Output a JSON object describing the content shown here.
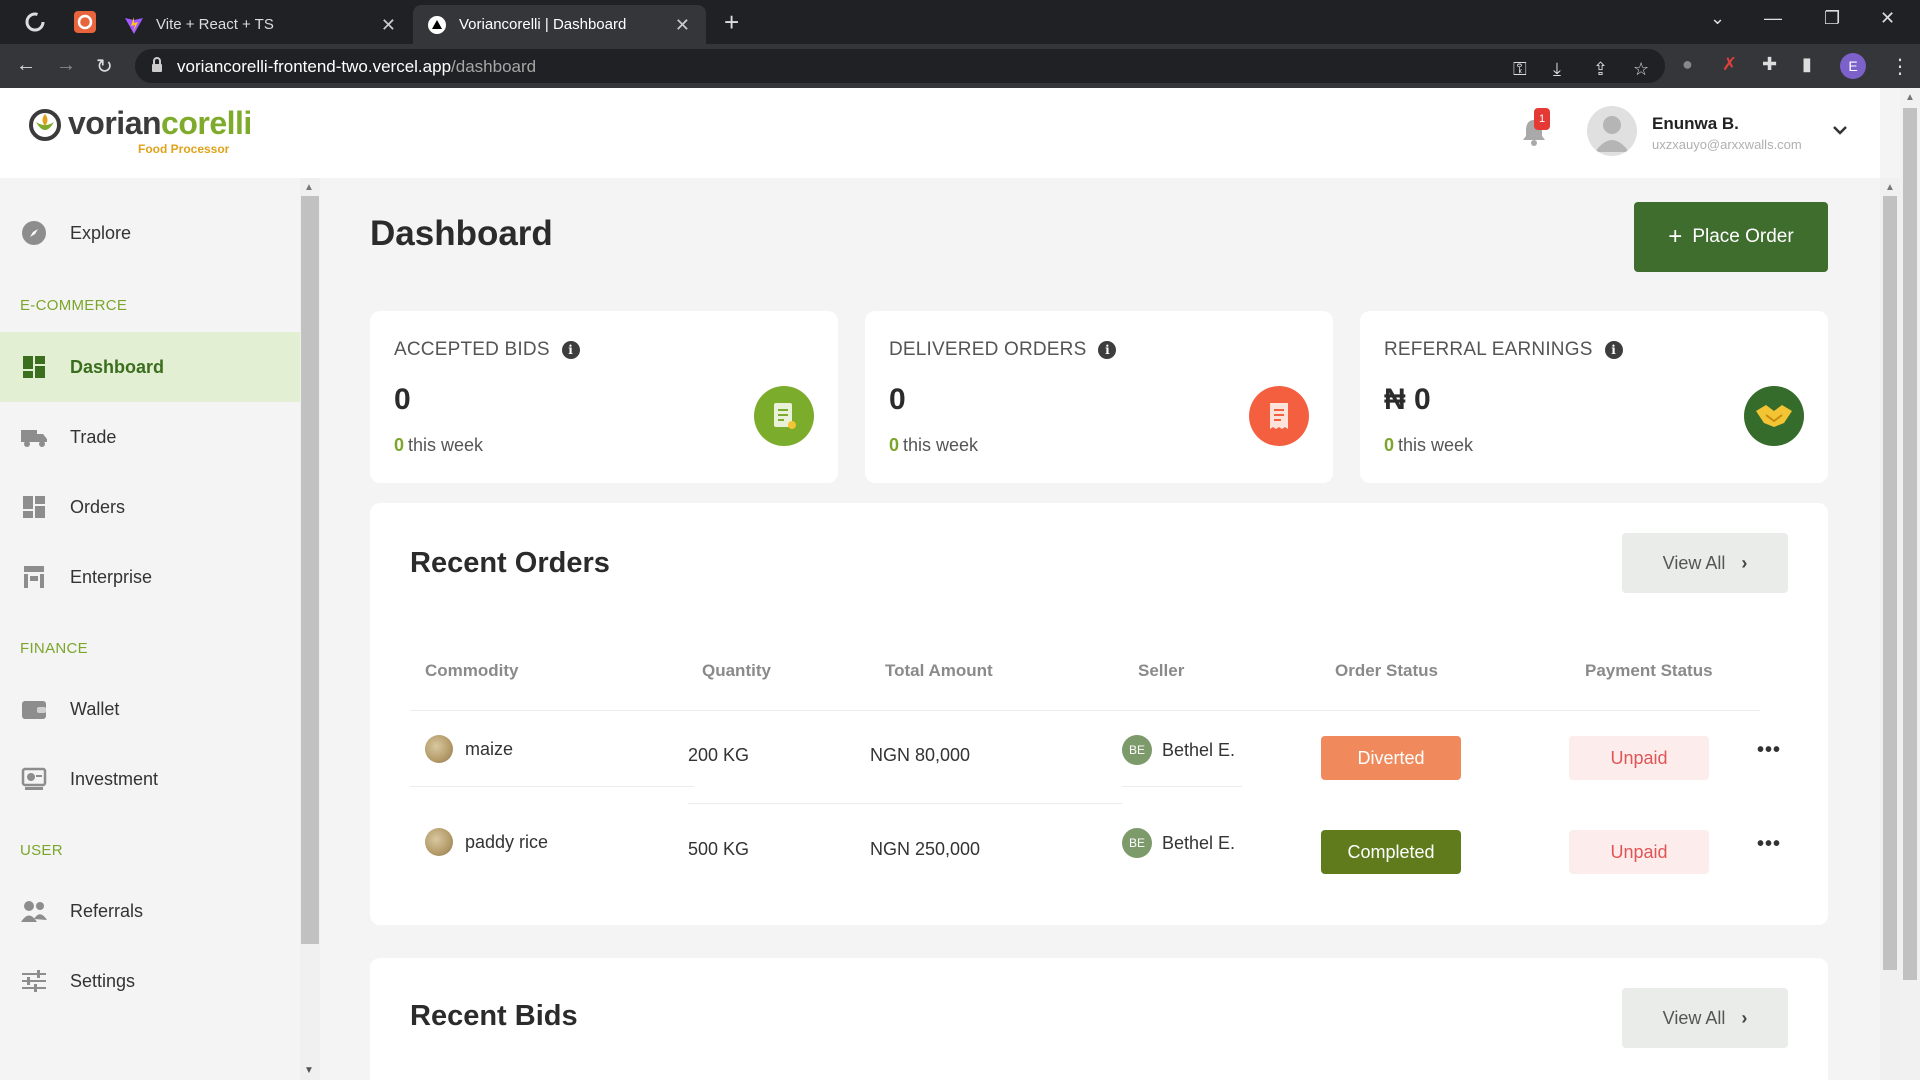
{
  "browser": {
    "tabs": [
      {
        "title": "Vite + React + TS"
      },
      {
        "title": "Voriancorelli | Dashboard"
      }
    ],
    "url_host": "voriancorelli-frontend-two.vercel.app",
    "url_path": "/dashboard",
    "profile_initial": "E"
  },
  "header": {
    "logo_text_1": "vorian",
    "logo_text_2": "corelli",
    "logo_sub": "Food Processor",
    "notification_count": "1",
    "user_name": "Enunwa B.",
    "user_email": "uxzxauyo@arxxwalls.com"
  },
  "sidebar": {
    "explore": "Explore",
    "section_ecommerce": "E-COMMERCE",
    "dashboard": "Dashboard",
    "trade": "Trade",
    "orders": "Orders",
    "enterprise": "Enterprise",
    "section_finance": "FINANCE",
    "wallet": "Wallet",
    "investment": "Investment",
    "section_user": "USER",
    "referrals": "Referrals",
    "settings": "Settings"
  },
  "main": {
    "title": "Dashboard",
    "place_order": "Place Order"
  },
  "stats": [
    {
      "title": "ACCEPTED BIDS",
      "value": "0",
      "week_value": "0",
      "week_label": "this week",
      "icon_color": "#7cac2c"
    },
    {
      "title": "DELIVERED ORDERS",
      "value": "0",
      "week_value": "0",
      "week_label": "this week",
      "icon_color": "#f4603f"
    },
    {
      "title": "REFERRAL EARNINGS",
      "value": "₦ 0",
      "week_value": "0",
      "week_label": "this week",
      "icon_color": "#356b2b"
    }
  ],
  "recent_orders": {
    "title": "Recent Orders",
    "view_all": "View All",
    "columns": [
      "Commodity",
      "Quantity",
      "Total Amount",
      "Seller",
      "Order Status",
      "Payment Status"
    ],
    "rows": [
      {
        "commodity": "maize",
        "quantity": "200 KG",
        "amount": "NGN 80,000",
        "seller_initials": "BE",
        "seller": "Bethel E.",
        "order_status": "Diverted",
        "order_status_color": "#f08a5d",
        "payment_status": "Unpaid"
      },
      {
        "commodity": "paddy rice",
        "quantity": "500 KG",
        "amount": "NGN 250,000",
        "seller_initials": "BE",
        "seller": "Bethel E.",
        "order_status": "Completed",
        "order_status_color": "#5f7b1c",
        "payment_status": "Unpaid"
      }
    ]
  },
  "recent_bids": {
    "title": "Recent Bids",
    "view_all": "View All"
  }
}
